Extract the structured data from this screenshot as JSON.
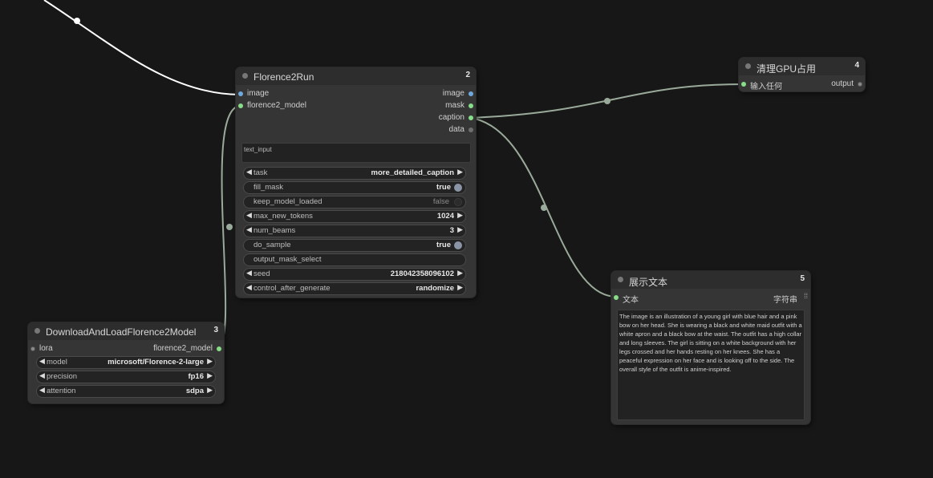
{
  "nodes": {
    "florence_run": {
      "title": "Florence2Run",
      "id": "2",
      "inputs": [
        "image",
        "florence2_model"
      ],
      "outputs": [
        "image",
        "mask",
        "caption",
        "data"
      ],
      "text_input_placeholder": "text_input",
      "widgets": {
        "task": {
          "label": "task",
          "value": "more_detailed_caption"
        },
        "fill_mask": {
          "label": "fill_mask",
          "value": "true"
        },
        "keep_model_loaded": {
          "label": "keep_model_loaded",
          "value": "false"
        },
        "max_new_tokens": {
          "label": "max_new_tokens",
          "value": "1024"
        },
        "num_beams": {
          "label": "num_beams",
          "value": "3"
        },
        "do_sample": {
          "label": "do_sample",
          "value": "true"
        },
        "output_mask_select": {
          "label": "output_mask_select",
          "value": ""
        },
        "seed": {
          "label": "seed",
          "value": "218042358096102"
        },
        "control_after_generate": {
          "label": "control_after_generate",
          "value": "randomize"
        }
      }
    },
    "gpu_clean": {
      "title": "清理GPU占用",
      "id": "4",
      "input": "输入任何",
      "output": "output"
    },
    "download_model": {
      "title": "DownloadAndLoadFlorence2Model",
      "id": "3",
      "input": "lora",
      "output": "florence2_model",
      "widgets": {
        "model": {
          "label": "model",
          "value": "microsoft/Florence-2-large"
        },
        "precision": {
          "label": "precision",
          "value": "fp16"
        },
        "attention": {
          "label": "attention",
          "value": "sdpa"
        }
      }
    },
    "show_text": {
      "title": "展示文本",
      "id": "5",
      "input": "文本",
      "output": "字符串",
      "text": "The image is an illustration of a young girl with blue hair and a pink bow on her head. She is wearing a black and white maid outfit with a white apron and a black bow at the waist. The outfit has a high collar and long sleeves. The girl is sitting on a white background with her legs crossed and her hands resting on her knees. She has a peaceful expression on her face and is looking off to the side. The overall style of the outfit is anime-inspired."
    }
  },
  "colors": {
    "background": "#171717",
    "node_body": "#353535",
    "node_header": "#2d2d2d",
    "link_image": "#ffffff",
    "link_model": "#9aaa9a",
    "slot_image": "#6fa8dc",
    "slot_green": "#88dd88"
  }
}
